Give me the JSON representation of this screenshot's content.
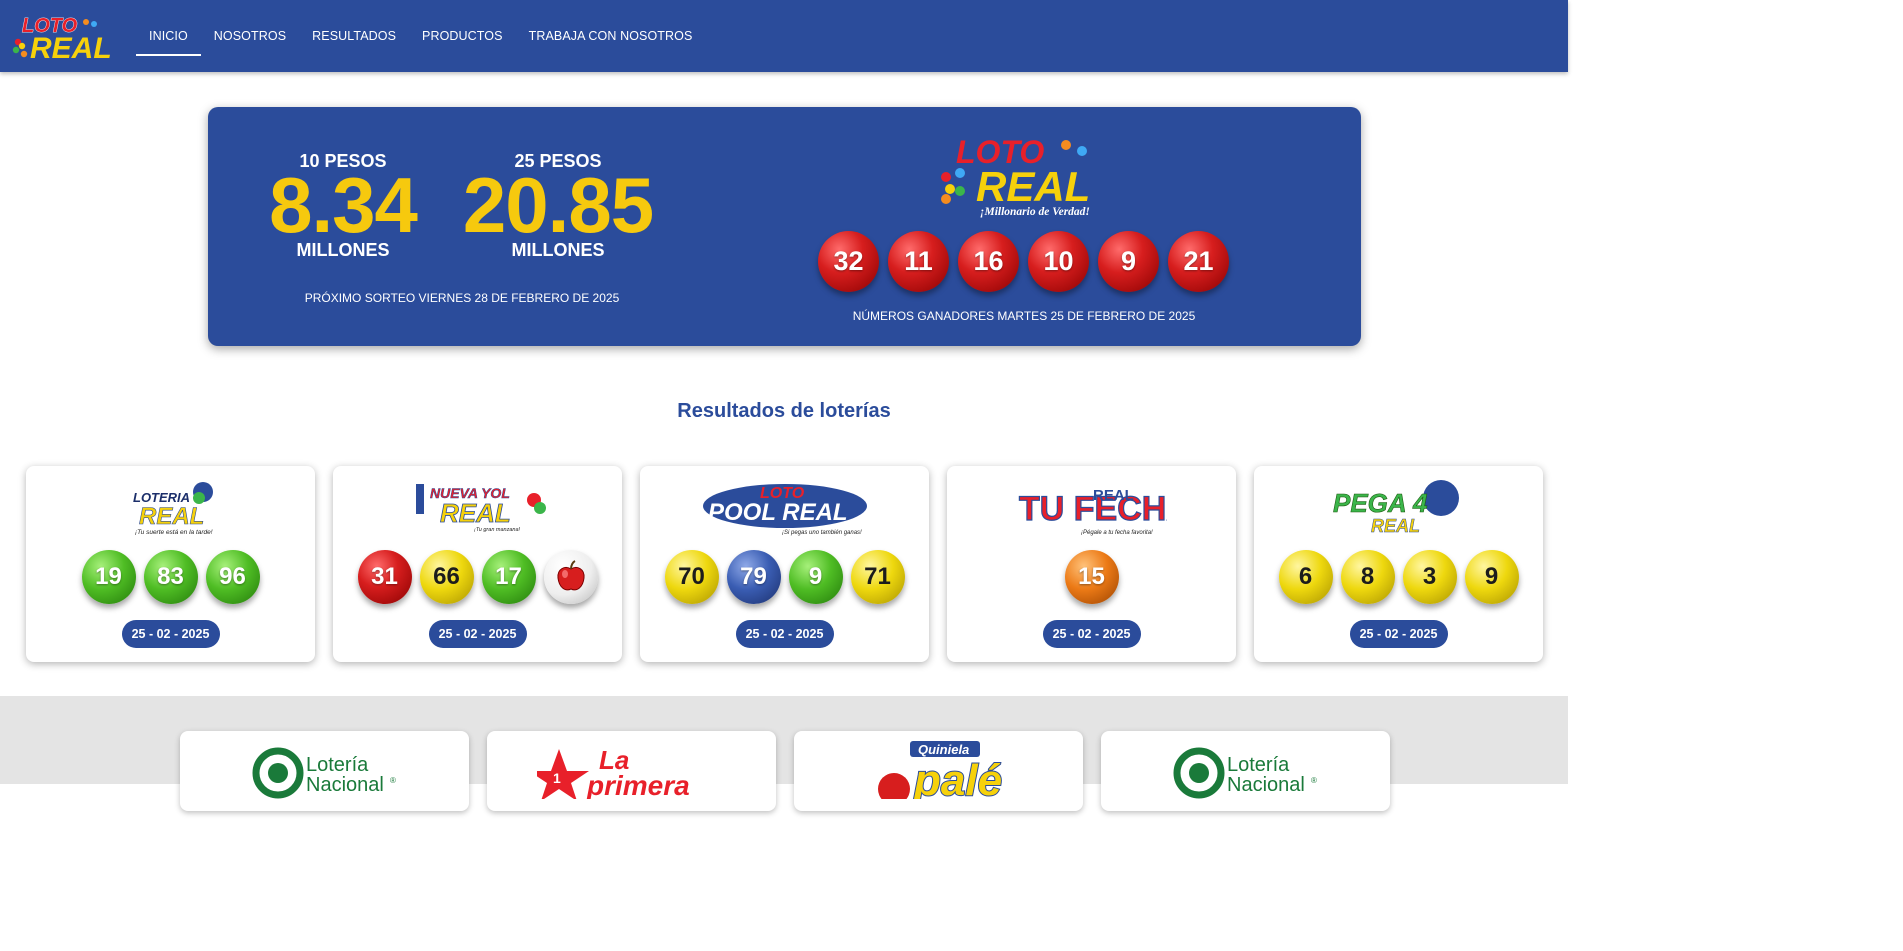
{
  "nav": {
    "brand": {
      "word1": "LOTO",
      "word2": "REAL"
    },
    "links": [
      "INICIO",
      "NOSOTROS",
      "RESULTADOS",
      "PRODUCTOS",
      "TRABAJA CON NOSOTROS"
    ],
    "active": "INICIO"
  },
  "jackpot": {
    "prize_10": {
      "denomination": "10 PESOS",
      "amount": "8.34",
      "unit": "MILLONES"
    },
    "prize_25": {
      "denomination": "25 PESOS",
      "amount": "20.85",
      "unit": "MILLONES"
    },
    "next_draw": "PRÓXIMO SORTEO VIERNES 28 DE FEBRERO DE 2025",
    "logo": {
      "word1": "LOTO",
      "word2": "REAL",
      "tagline": "¡Millonario de Verdad!"
    },
    "winning_numbers": [
      "32",
      "11",
      "16",
      "10",
      "9",
      "21"
    ],
    "winners_date": "NÚMEROS GANADORES MARTES 25 DE FEBRERO DE 2025"
  },
  "results": {
    "title": "Resultados de loterías",
    "cards": [
      {
        "logo": {
          "line1": "LOTERIA",
          "line2": "REAL",
          "tagline": "¡Tu suerte está en la tarde!"
        },
        "balls": [
          {
            "n": "19",
            "color": "green"
          },
          {
            "n": "83",
            "color": "green"
          },
          {
            "n": "96",
            "color": "green"
          }
        ],
        "date": "25 - 02 - 2025"
      },
      {
        "logo": {
          "line1": "NUEVA YOL",
          "line2": "REAL",
          "tagline": "¡Tu gran manzana!"
        },
        "balls": [
          {
            "n": "31",
            "color": "red"
          },
          {
            "n": "66",
            "color": "yellow"
          },
          {
            "n": "17",
            "color": "green"
          },
          {
            "n": "",
            "color": "white",
            "icon": "apple-icon"
          }
        ],
        "date": "25 - 02 - 2025"
      },
      {
        "logo": {
          "line1": "LOTO",
          "line2": "POOL REAL",
          "tagline": "¡Si pegas uno también ganas!"
        },
        "balls": [
          {
            "n": "70",
            "color": "yellow"
          },
          {
            "n": "79",
            "color": "blue"
          },
          {
            "n": "9",
            "color": "green"
          },
          {
            "n": "71",
            "color": "yellow"
          }
        ],
        "date": "25 - 02 - 2025"
      },
      {
        "logo": {
          "line1": "TU FECHA",
          "line2": "REAL",
          "tagline": "¡Pégale a tu fecha favorita!"
        },
        "balls": [
          {
            "n": "15",
            "color": "orange"
          }
        ],
        "date": "25 - 02 - 2025"
      },
      {
        "logo": {
          "line1": "PEGA 4",
          "line2": "REAL",
          "tagline": ""
        },
        "balls": [
          {
            "n": "6",
            "color": "yellow"
          },
          {
            "n": "8",
            "color": "yellow"
          },
          {
            "n": "3",
            "color": "yellow"
          },
          {
            "n": "9",
            "color": "yellow"
          }
        ],
        "date": "25 - 02 - 2025"
      }
    ]
  },
  "lower": {
    "cards": [
      {
        "line1": "Lotería",
        "line2": "Nacional",
        "mark": "®"
      },
      {
        "line1": "La",
        "line2": "primera",
        "mark": "1"
      },
      {
        "line1": "Quiniela",
        "line2": "palé",
        "mark": ""
      },
      {
        "line1": "Lotería",
        "line2": "Nacional",
        "mark": "®"
      }
    ]
  },
  "colors": {
    "brand_blue": "#2b4c9b",
    "jackpot_yellow": "#f6c90e",
    "logo_red": "#e8202a",
    "logo_yellow": "#f6d10b"
  }
}
